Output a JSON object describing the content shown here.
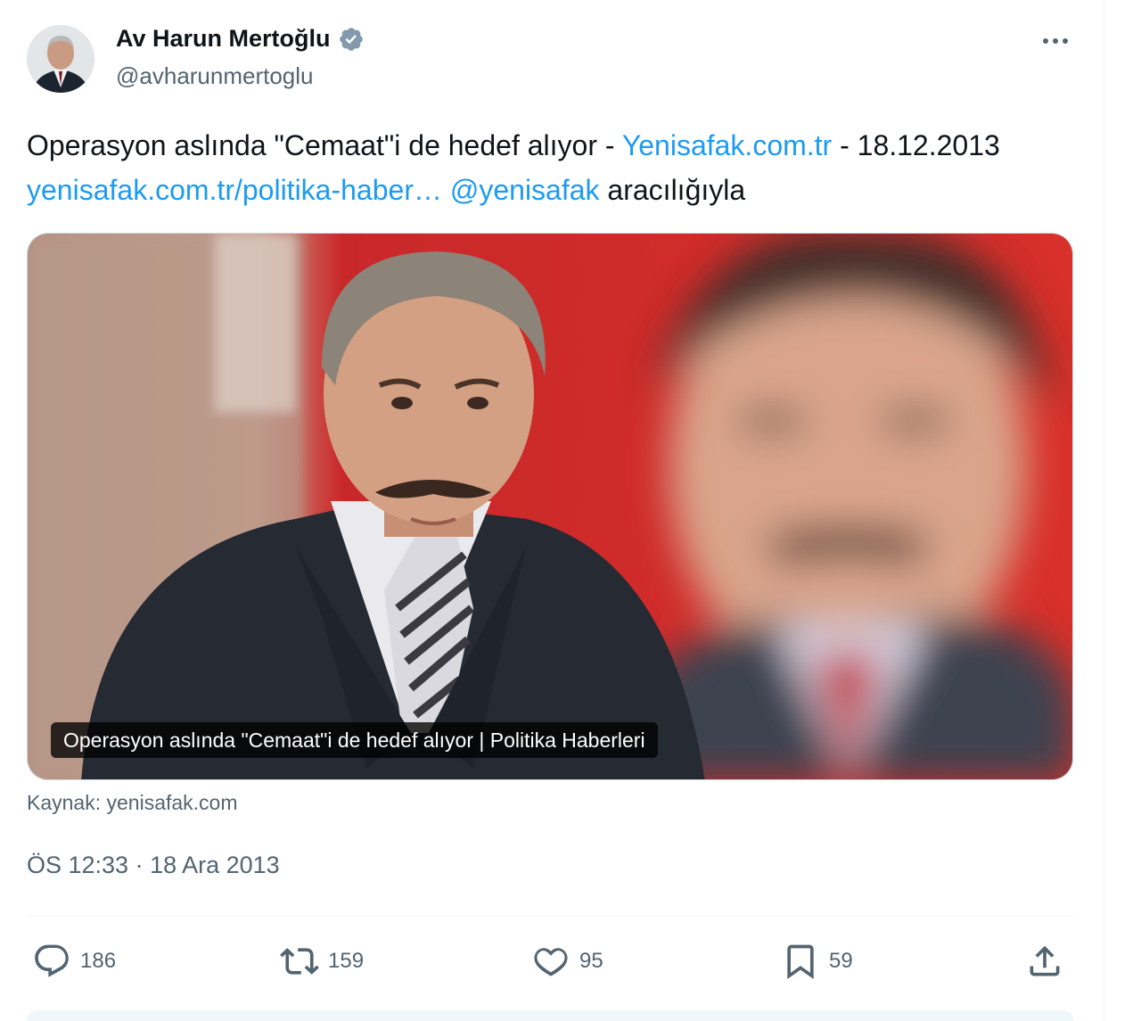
{
  "author": {
    "name": "Av Harun Mertoğlu",
    "handle": "@avharunmertoglu",
    "verified": true
  },
  "tweet": {
    "text_1": "Operasyon aslında \"Cemaat\"i de hedef alıyor - ",
    "link_site": "Yenisafak.com.tr",
    "text_2": " - 18.12.2013 ",
    "link_url": "yenisafak.com.tr/politika-haber…",
    "space": " ",
    "mention": "@yenisafak",
    "text_3": " aracılığıyla"
  },
  "card": {
    "caption": "Operasyon aslında \"Cemaat\"i de hedef alıyor | Politika Haberleri",
    "source": "Kaynak: yenisafak.com"
  },
  "timestamp": "ÖS 12:33 · 18 Ara 2013",
  "actions": {
    "replies": "186",
    "reposts": "159",
    "likes": "95",
    "bookmarks": "59"
  },
  "colors": {
    "link": "#1d9bf0",
    "secondary_text": "#536471",
    "verified_badge": "#829aab"
  },
  "icons": [
    "verified-icon",
    "more-icon",
    "reply-icon",
    "repost-icon",
    "like-icon",
    "bookmark-icon",
    "share-icon"
  ]
}
